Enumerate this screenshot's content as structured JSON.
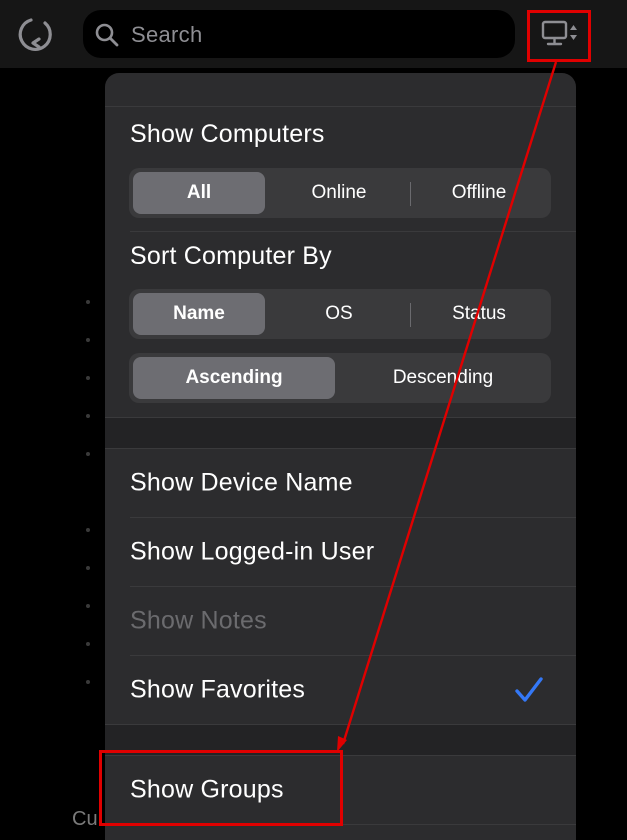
{
  "search": {
    "placeholder": "Search"
  },
  "icons": {
    "refresh": "refresh-icon",
    "search": "search-icon",
    "computer_sort": "computer-sort-icon",
    "checkmark": "checkmark-icon"
  },
  "colors": {
    "accent": "#3478f6",
    "annotation": "#e00000",
    "menu_background": "#2c2c2e",
    "selected_segment": "#6d6d72"
  },
  "background": {
    "partial_text": "Cu"
  },
  "menu": {
    "show_computers": {
      "title": "Show Computers",
      "options": [
        "All",
        "Online",
        "Offline"
      ],
      "selected": "All"
    },
    "sort_by": {
      "title": "Sort Computer By",
      "options": [
        "Name",
        "OS",
        "Status"
      ],
      "selected": "Name"
    },
    "order": {
      "options": [
        "Ascending",
        "Descending"
      ],
      "selected": "Ascending"
    },
    "display_options": [
      {
        "label": "Show Device Name",
        "checked": false,
        "enabled": true
      },
      {
        "label": "Show Logged-in User",
        "checked": false,
        "enabled": true
      },
      {
        "label": "Show Notes",
        "checked": false,
        "enabled": false
      },
      {
        "label": "Show Favorites",
        "checked": true,
        "enabled": true
      }
    ],
    "groups_option": {
      "label": "Show Groups"
    }
  }
}
